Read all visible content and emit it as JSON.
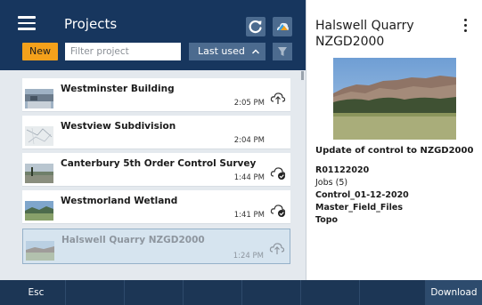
{
  "header": {
    "title": "Projects",
    "new_label": "New",
    "filter_placeholder": "Filter project",
    "sort_label": "Last used",
    "icons": {
      "menu": "hamburger-menu-icon",
      "refresh": "refresh-icon",
      "sync": "cloud-sync-icon",
      "filter": "filter-icon",
      "sort_chevron": "chevron-up-icon"
    }
  },
  "projects": [
    {
      "name": "Westminster Building",
      "time": "2:05 PM",
      "cloud": "cloud-upload-icon"
    },
    {
      "name": "Westview Subdivision",
      "time": "2:04 PM",
      "cloud": ""
    },
    {
      "name": "Canterbury 5th Order Control Survey",
      "time": "1:44 PM",
      "cloud": "cloud-synced-icon"
    },
    {
      "name": "Westmorland Wetland",
      "time": "1:41 PM",
      "cloud": "cloud-synced-icon"
    },
    {
      "name": "Halswell Quarry NZGD2000",
      "time": "1:24 PM",
      "cloud": "cloud-upload-icon"
    }
  ],
  "selected_index": 4,
  "detail": {
    "title": "Halswell Quarry NZGD2000",
    "description": "Update of control to NZGD2000",
    "reference": "R01122020",
    "jobs_label": "Jobs (5)",
    "jobs": [
      "Control_01-12-2020",
      "Master_Field_Files",
      "Topo"
    ]
  },
  "bottom_bar": {
    "esc_label": "Esc",
    "download_label": "Download"
  },
  "colors": {
    "header_bg": "#17365e",
    "accent_orange": "#f4a11b",
    "button_blue": "#4c6b8f",
    "bottom_bar": "#1c3655",
    "selected_row": "#d6e4ef"
  }
}
